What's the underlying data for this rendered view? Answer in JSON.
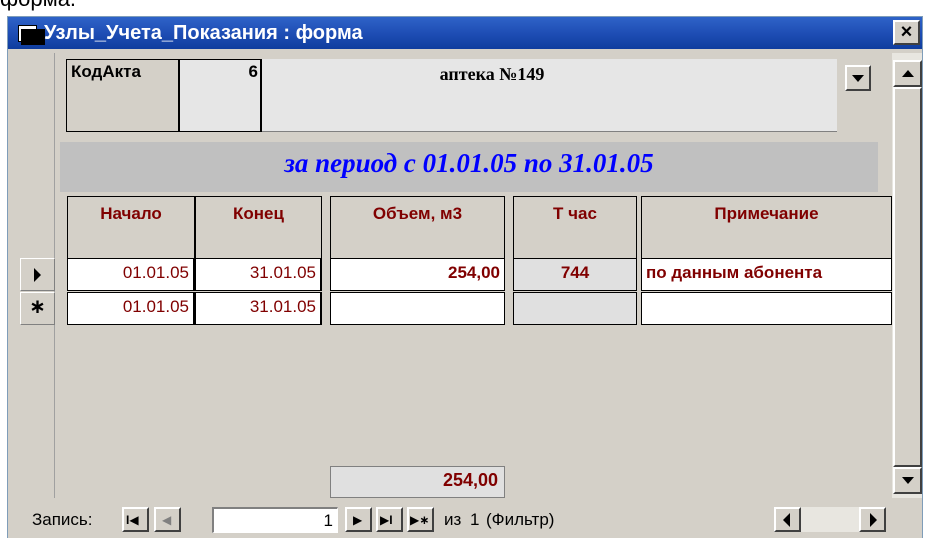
{
  "outer_caption": "форма.",
  "window": {
    "title": "Узлы_Учета_Показания : форма",
    "close_label": "×"
  },
  "header": {
    "kod_label": "КодАкта",
    "kod_value": "6",
    "apteka": "аптека №149",
    "period": "за период с 01.01.05 по 31.01.05"
  },
  "columns": [
    "Начало",
    "Конец",
    "Объем, м3",
    "Т час",
    "Примечание"
  ],
  "rows": [
    {
      "nachalo": "01.01.05",
      "konec": "31.01.05",
      "obem": "254,00",
      "tchas": "744",
      "prim": "по данным абонента"
    },
    {
      "nachalo": "01.01.05",
      "konec": "31.01.05",
      "obem": "",
      "tchas": "",
      "prim": ""
    }
  ],
  "new_record_marker": "∗",
  "total": "254,00",
  "navigation": {
    "label": "Запись:",
    "first": "I◀",
    "prev": "◀",
    "current": "1",
    "next": "▶",
    "last": "▶I",
    "new": "▶∗",
    "of_label": "из",
    "count": "1",
    "filter": "(Фильтр)"
  }
}
